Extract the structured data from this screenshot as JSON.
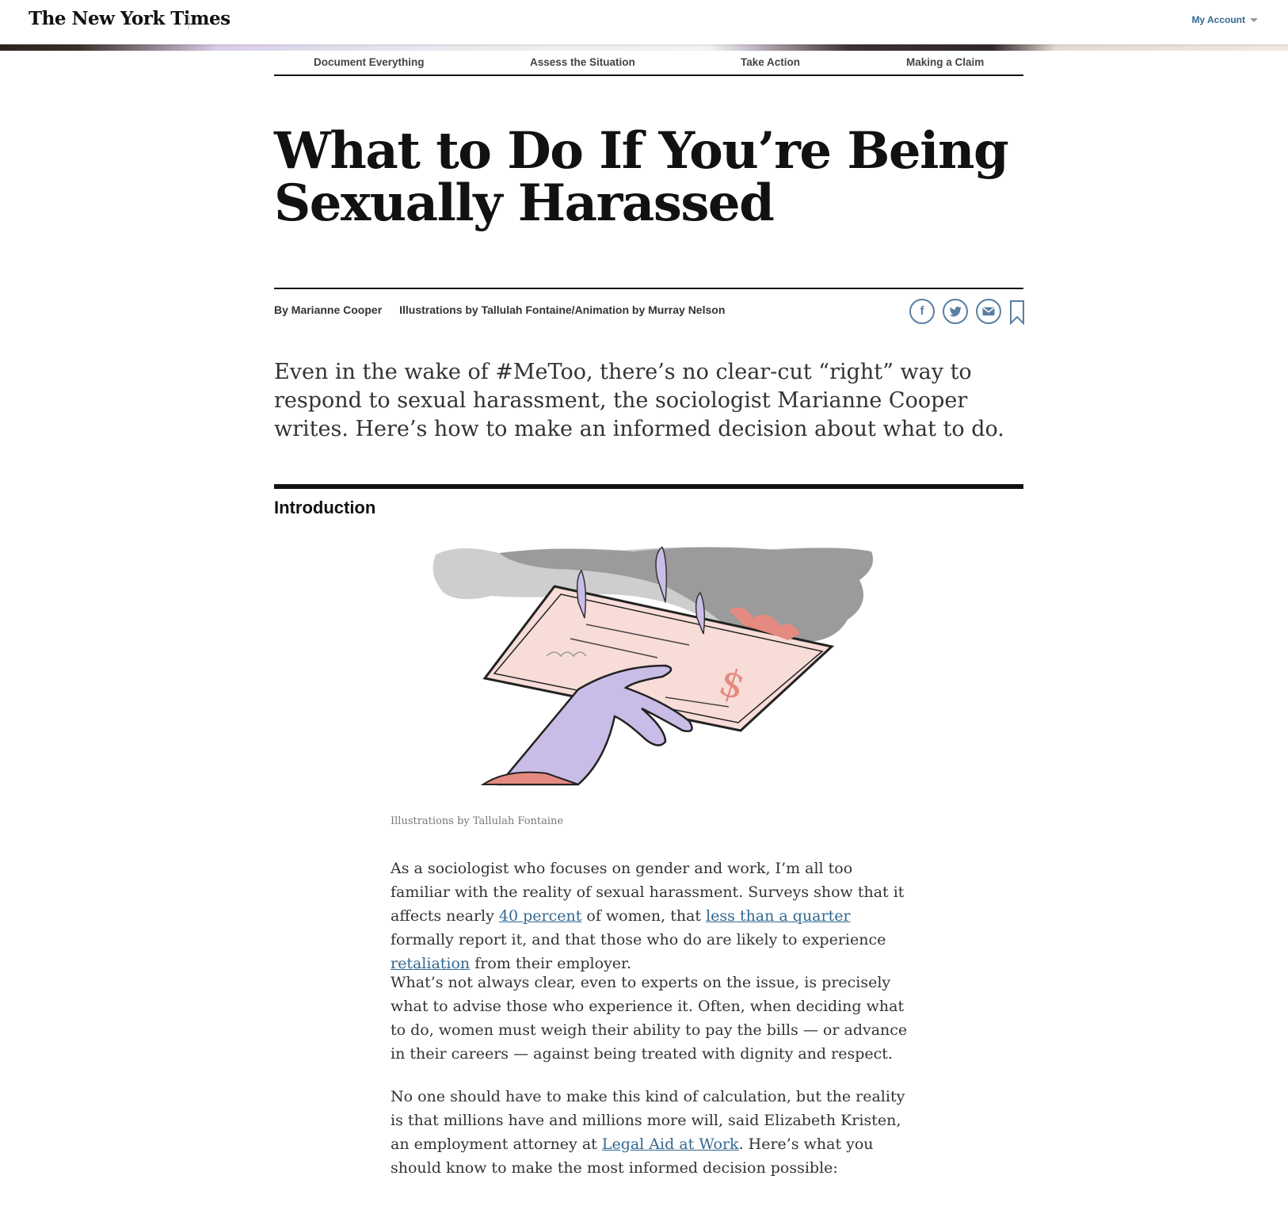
{
  "masthead": {
    "logo": "The New York Times",
    "account_label": "My Account"
  },
  "section_nav": [
    "Document Everything",
    "Assess the Situation",
    "Take Action",
    "Making a Claim"
  ],
  "article": {
    "headline": "What to Do If You’re Being Sexually Harassed",
    "byline": "By Marianne Cooper",
    "credit": "Illustrations by Tallulah Fontaine/Animation by Murray Nelson",
    "summary": "Even in the wake of #MeToo, there’s no clear-cut “right” way to respond to sexual harassment, the sociologist Marianne Cooper writes. Here’s how to make an informed decision about what to do.",
    "section_label": "Introduction",
    "illustration_caption": "Illustrations by Tallulah Fontaine",
    "p1": {
      "t1": "As a sociologist who focuses on gender and work, I’m all too familiar with the reality of sexual harassment. Surveys show that it affects nearly ",
      "link1": "40 percent",
      "t2": " of women, that ",
      "link2": "less than a quarter",
      "t3": " formally report it, and that those who do are likely to experience ",
      "link3": "retaliation",
      "t4": " from their employer."
    },
    "p2": "What’s not always clear, even to experts on the issue, is precisely what to advise those who experience it. Often, when deciding what to do, women must weigh their ability to pay the bills — or advance in their careers — against being treated with dignity and respect.",
    "p3": {
      "t1": "No one should have to make this kind of calculation, but the reality is that millions have and millions more will, said Elizabeth Kristen, an employment attorney at ",
      "link1": "Legal Aid at Work",
      "t2": ". Here’s what you should know to make the most informed decision possible:"
    }
  },
  "share_icons": [
    "facebook-icon",
    "twitter-icon",
    "email-icon",
    "bookmark-icon"
  ],
  "colors": {
    "link": "#326891",
    "share_icon": "#5a7fa3",
    "hand": "#c9bde8",
    "check": "#f7dcd8",
    "smoke": "#9a9a9a"
  }
}
